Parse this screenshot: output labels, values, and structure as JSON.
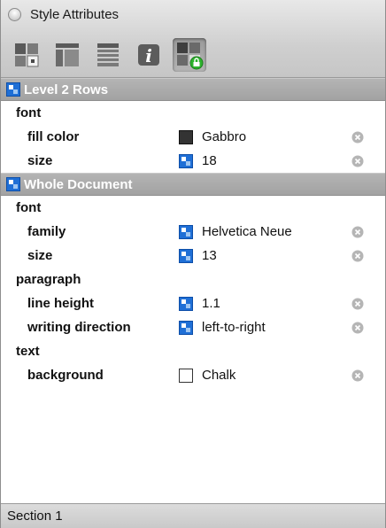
{
  "window": {
    "title": "Style Attributes"
  },
  "toolbar": {
    "tools": [
      {
        "icon": "style-preview-icon",
        "active": false
      },
      {
        "icon": "columns-layout-icon",
        "active": false
      },
      {
        "icon": "rows-layout-icon",
        "active": false
      },
      {
        "icon": "info-icon",
        "active": false
      },
      {
        "icon": "locked-style-icon",
        "active": true
      }
    ]
  },
  "sections": [
    {
      "title": "Level 2 Rows",
      "groups": [
        {
          "label": "font",
          "attrs": [
            {
              "name": "fill color",
              "swatch": "dark",
              "swatch_color": "#333333",
              "value": "Gabbro"
            },
            {
              "name": "size",
              "swatch": "style",
              "value": "18"
            }
          ]
        }
      ]
    },
    {
      "title": "Whole Document",
      "groups": [
        {
          "label": "font",
          "attrs": [
            {
              "name": "family",
              "swatch": "style",
              "value": "Helvetica Neue"
            },
            {
              "name": "size",
              "swatch": "style",
              "value": "13"
            }
          ]
        },
        {
          "label": "paragraph",
          "attrs": [
            {
              "name": "line height",
              "swatch": "style",
              "value": "1.1"
            },
            {
              "name": "writing direction",
              "swatch": "style",
              "value": "left-to-right"
            }
          ]
        },
        {
          "label": "text",
          "attrs": [
            {
              "name": "background",
              "swatch": "light",
              "swatch_color": "#ffffff",
              "value": "Chalk"
            }
          ]
        }
      ]
    }
  ],
  "status": {
    "text": "Section 1"
  },
  "colors": {
    "accent_blue": "#1f6fd6",
    "header_gray": "#a8a8a8",
    "lock_green": "#2db32d"
  }
}
